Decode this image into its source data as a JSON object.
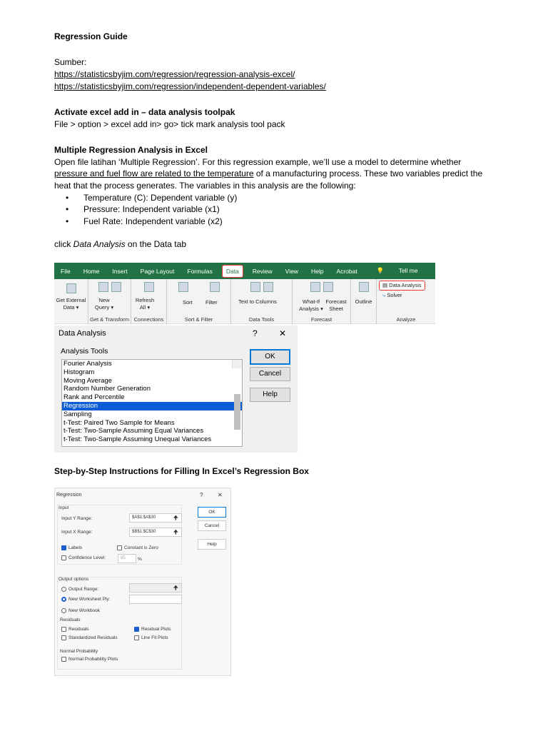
{
  "doc": {
    "title": "Regression Guide",
    "source_label": "Sumber:",
    "links": [
      "https://statisticsbyjim.com/regression/regression-analysis-excel/",
      "https://statisticsbyjim.com/regression/independent-dependent-variables/"
    ],
    "h_activate": "Activate excel add in – data analysis toolpak",
    "activate_text": "File > option > excel add in> go> tick mark analysis tool pack",
    "h_multi": "Multiple Regression Analysis in Excel",
    "para1a": "Open file latihan ‘Multiple Regression’. For this regression example, we’ll use a model to determine whether",
    "para2_underlined": "pressure and fuel flow are related to the temperature",
    "para2_rest": " of a manufacturing process.  These two variables predict the",
    "para3": "heat that the process generates. The variables in this analysis are the following:",
    "bullets": [
      "Temperature (C): Dependent variable (y)",
      "Pressure: Independent variable (x1)",
      "Fuel Rate: Independent variable (x2)"
    ],
    "click_pre": "click ",
    "click_em": "Data Analysis",
    "click_post": " on the Data tab",
    "h_steps": "Step-by-Step Instructions for Filling In Excel’s Regression Box"
  },
  "ribbon": {
    "tabs": [
      "File",
      "Home",
      "Insert",
      "Page Layout",
      "Formulas",
      "Data",
      "Review",
      "View",
      "Help",
      "Acrobat",
      "Tell me"
    ],
    "buttons": {
      "get_external": "Get External Data ▾",
      "new_query": "New Query ▾",
      "refresh": "Refresh All ▾",
      "sort": "Sort",
      "filter": "Filter",
      "text_to_columns": "Text to Columns",
      "what_if": "What-If Analysis ▾",
      "forecast_sheet": "Forecast Sheet",
      "outline": "Outline",
      "data_analysis": "Data Analysis",
      "solver": "Solver"
    },
    "groups": [
      "Get & Transform",
      "Connections",
      "Sort & Filter",
      "Data Tools",
      "Forecast",
      "Analyze"
    ]
  },
  "data_analysis": {
    "title": "Data Analysis",
    "help": "?",
    "close": "✕",
    "tools_label": "Analysis Tools",
    "tools": [
      "Fourier Analysis",
      "Histogram",
      "Moving Average",
      "Random Number Generation",
      "Rank and Percentile",
      "Regression",
      "Sampling",
      "t-Test: Paired Two Sample for Means",
      "t-Test: Two-Sample Assuming Equal Variances",
      "t-Test: Two-Sample Assuming Unequal Variances"
    ],
    "selected": "Regression",
    "ok": "OK",
    "cancel": "Cancel",
    "help_btn": "Help"
  },
  "regression": {
    "title": "Regression",
    "help": "?",
    "close": "✕",
    "input_label": "Input",
    "y_label": "Input Y Range:",
    "y_value": "$A$1:$A$30",
    "x_label": "Input X Range:",
    "x_value": "$B$1:$C$30",
    "labels": "Labels",
    "constant_zero": "Constant is Zero",
    "confidence": "Confidence Level:",
    "confidence_value": "95",
    "percent": "%",
    "output_label": "Output options",
    "output_range": "Output Range:",
    "new_ply": "New Worksheet Ply:",
    "new_workbook": "New Workbook",
    "residuals_label": "Residuals",
    "residuals": "Residuals",
    "residual_plots": "Residual Plots",
    "std_residuals": "Standardized Residuals",
    "line_fit": "Line Fit Plots",
    "normal_label": "Normal Probability",
    "normal_plots": "Normal Probability Plots",
    "ok": "OK",
    "cancel": "Cancel",
    "help_btn": "Help",
    "arrow": "🠉"
  }
}
